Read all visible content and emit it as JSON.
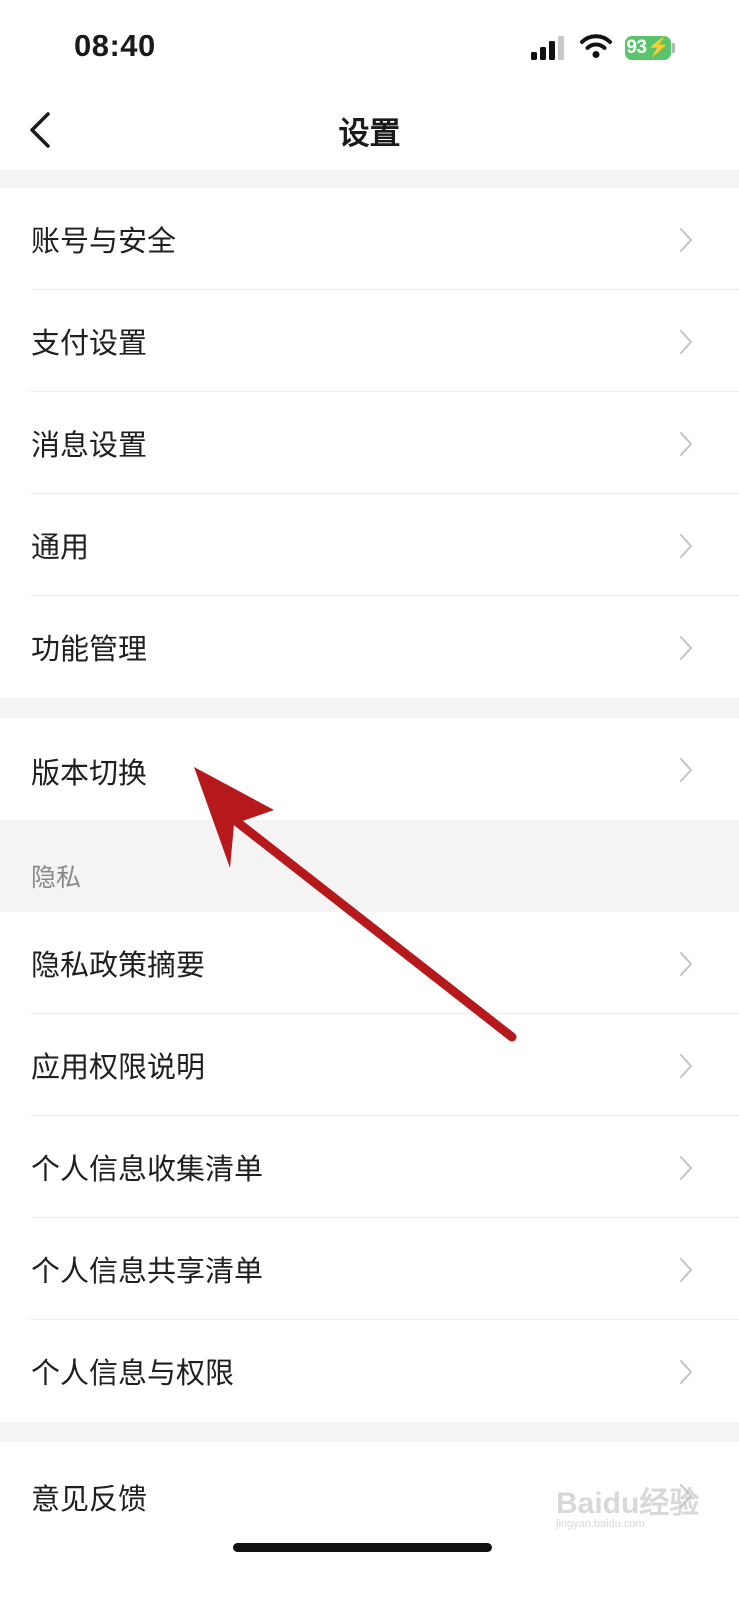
{
  "status_bar": {
    "time": "08:40",
    "battery": "93"
  },
  "header": {
    "title": "设置"
  },
  "group1": {
    "items": [
      {
        "label": "账号与安全"
      },
      {
        "label": "支付设置"
      },
      {
        "label": "消息设置"
      },
      {
        "label": "通用"
      },
      {
        "label": "功能管理"
      }
    ]
  },
  "group2": {
    "items": [
      {
        "label": "版本切换"
      }
    ]
  },
  "privacy": {
    "header": "隐私",
    "items": [
      {
        "label": "隐私政策摘要"
      },
      {
        "label": "应用权限说明"
      },
      {
        "label": "个人信息收集清单"
      },
      {
        "label": "个人信息共享清单"
      },
      {
        "label": "个人信息与权限"
      }
    ]
  },
  "group4": {
    "items": [
      {
        "label": "意见反馈"
      }
    ]
  },
  "watermark": {
    "text": "Baidu经验",
    "sub": "jingyan.baidu.com"
  },
  "colors": {
    "background": "#f4f4f4",
    "battery_green": "#5ac46c",
    "annotation_red": "#b5191c",
    "section_header_text": "#8a8a8a"
  }
}
